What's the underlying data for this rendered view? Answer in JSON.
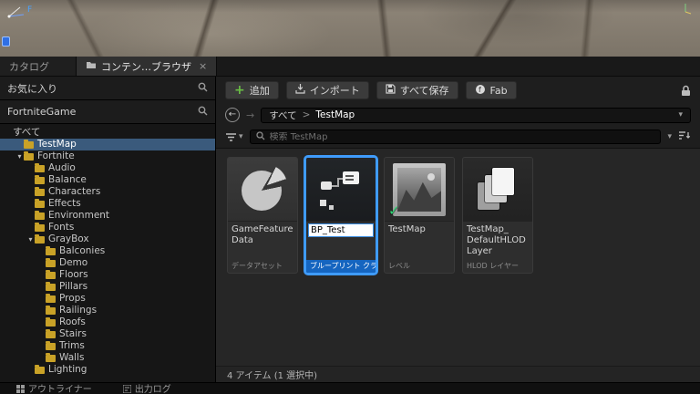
{
  "viewport": {
    "gizmo_label": "F"
  },
  "panel_tabs": {
    "catalog": "カタログ",
    "content_browser": "コンテン…ブラウザ",
    "close": "×"
  },
  "icons": {
    "back": "←",
    "forward": "→",
    "chevron_down": "▾",
    "caret_expanded": "▾",
    "plus": "+",
    "check": "✓"
  },
  "sidebar": {
    "favorites_label": "お気に入り",
    "project_label": "FortniteGame",
    "tree": [
      {
        "label": "すべて",
        "indent": 0,
        "icon": "none",
        "selected": false,
        "expanded": false
      },
      {
        "label": "TestMap",
        "indent": 1,
        "icon": "folder",
        "selected": true,
        "expanded": false
      },
      {
        "label": "Fortnite",
        "indent": 1,
        "icon": "folder",
        "selected": false,
        "expanded": true
      },
      {
        "label": "Audio",
        "indent": 2,
        "icon": "folder",
        "selected": false,
        "expanded": false
      },
      {
        "label": "Balance",
        "indent": 2,
        "icon": "folder",
        "selected": false,
        "expanded": false
      },
      {
        "label": "Characters",
        "indent": 2,
        "icon": "folder",
        "selected": false,
        "expanded": false
      },
      {
        "label": "Effects",
        "indent": 2,
        "icon": "folder",
        "selected": false,
        "expanded": false
      },
      {
        "label": "Environment",
        "indent": 2,
        "icon": "folder",
        "selected": false,
        "expanded": false
      },
      {
        "label": "Fonts",
        "indent": 2,
        "icon": "folder",
        "selected": false,
        "expanded": false
      },
      {
        "label": "GrayBox",
        "indent": 2,
        "icon": "folder",
        "selected": false,
        "expanded": true
      },
      {
        "label": "Balconies",
        "indent": 3,
        "icon": "folder",
        "selected": false,
        "expanded": false
      },
      {
        "label": "Demo",
        "indent": 3,
        "icon": "folder",
        "selected": false,
        "expanded": false
      },
      {
        "label": "Floors",
        "indent": 3,
        "icon": "folder",
        "selected": false,
        "expanded": false
      },
      {
        "label": "Pillars",
        "indent": 3,
        "icon": "folder",
        "selected": false,
        "expanded": false
      },
      {
        "label": "Props",
        "indent": 3,
        "icon": "folder",
        "selected": false,
        "expanded": false
      },
      {
        "label": "Railings",
        "indent": 3,
        "icon": "folder",
        "selected": false,
        "expanded": false
      },
      {
        "label": "Roofs",
        "indent": 3,
        "icon": "folder",
        "selected": false,
        "expanded": false
      },
      {
        "label": "Stairs",
        "indent": 3,
        "icon": "folder",
        "selected": false,
        "expanded": false
      },
      {
        "label": "Trims",
        "indent": 3,
        "icon": "folder",
        "selected": false,
        "expanded": false
      },
      {
        "label": "Walls",
        "indent": 3,
        "icon": "folder",
        "selected": false,
        "expanded": false
      },
      {
        "label": "Lighting",
        "indent": 2,
        "icon": "folder",
        "selected": false,
        "expanded": false
      }
    ]
  },
  "toolbar": {
    "add_label": "追加",
    "import_label": "インポート",
    "save_all_label": "すべて保存",
    "fab_label": "Fab"
  },
  "breadcrumb": {
    "root": "すべて",
    "separator": ">",
    "current": "TestMap"
  },
  "filter_bar": {
    "search_text": "検索 TestMap"
  },
  "assets": [
    {
      "name": "GameFeature Data",
      "type_label": "データアセット",
      "icon": "pie",
      "selected": false,
      "renaming": false,
      "checked": false
    },
    {
      "name": "BP_Test",
      "type_label": "ブループリント クラス",
      "icon": "blueprint",
      "selected": true,
      "renaming": true,
      "checked": false
    },
    {
      "name": "TestMap",
      "type_label": "レベル",
      "icon": "level",
      "selected": false,
      "renaming": false,
      "checked": true
    },
    {
      "name": "TestMap_ DefaultHLOD Layer",
      "type_label": "HLOD レイヤー",
      "icon": "hlod",
      "selected": false,
      "renaming": false,
      "checked": false
    }
  ],
  "status_bar": {
    "items_text": "4 アイテム (1 選択中)"
  },
  "bottom_tabs": [
    {
      "label": "アウトライナー"
    },
    {
      "label": "出力ログ"
    }
  ],
  "colors": {
    "selection_blue": "#3a5a7c",
    "accent_blue": "#3f9bfa",
    "blueprint_blue": "#1565c0",
    "add_green": "#6abe45",
    "check_green": "#2ed573",
    "folder_yellow": "#c9a227"
  }
}
